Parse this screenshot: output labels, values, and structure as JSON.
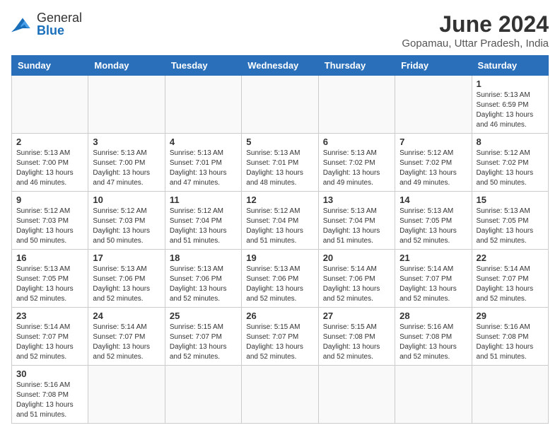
{
  "header": {
    "logo_general": "General",
    "logo_blue": "Blue",
    "month_title": "June 2024",
    "location": "Gopamau, Uttar Pradesh, India"
  },
  "weekdays": [
    "Sunday",
    "Monday",
    "Tuesday",
    "Wednesday",
    "Thursday",
    "Friday",
    "Saturday"
  ],
  "weeks": [
    [
      {
        "day": "",
        "info": ""
      },
      {
        "day": "",
        "info": ""
      },
      {
        "day": "",
        "info": ""
      },
      {
        "day": "",
        "info": ""
      },
      {
        "day": "",
        "info": ""
      },
      {
        "day": "",
        "info": ""
      },
      {
        "day": "1",
        "info": "Sunrise: 5:13 AM\nSunset: 6:59 PM\nDaylight: 13 hours and 46 minutes."
      }
    ],
    [
      {
        "day": "2",
        "info": "Sunrise: 5:13 AM\nSunset: 7:00 PM\nDaylight: 13 hours and 46 minutes."
      },
      {
        "day": "3",
        "info": "Sunrise: 5:13 AM\nSunset: 7:00 PM\nDaylight: 13 hours and 47 minutes."
      },
      {
        "day": "4",
        "info": "Sunrise: 5:13 AM\nSunset: 7:01 PM\nDaylight: 13 hours and 47 minutes."
      },
      {
        "day": "5",
        "info": "Sunrise: 5:13 AM\nSunset: 7:01 PM\nDaylight: 13 hours and 48 minutes."
      },
      {
        "day": "6",
        "info": "Sunrise: 5:13 AM\nSunset: 7:02 PM\nDaylight: 13 hours and 49 minutes."
      },
      {
        "day": "7",
        "info": "Sunrise: 5:12 AM\nSunset: 7:02 PM\nDaylight: 13 hours and 49 minutes."
      },
      {
        "day": "8",
        "info": "Sunrise: 5:12 AM\nSunset: 7:02 PM\nDaylight: 13 hours and 50 minutes."
      }
    ],
    [
      {
        "day": "9",
        "info": "Sunrise: 5:12 AM\nSunset: 7:03 PM\nDaylight: 13 hours and 50 minutes."
      },
      {
        "day": "10",
        "info": "Sunrise: 5:12 AM\nSunset: 7:03 PM\nDaylight: 13 hours and 50 minutes."
      },
      {
        "day": "11",
        "info": "Sunrise: 5:12 AM\nSunset: 7:04 PM\nDaylight: 13 hours and 51 minutes."
      },
      {
        "day": "12",
        "info": "Sunrise: 5:12 AM\nSunset: 7:04 PM\nDaylight: 13 hours and 51 minutes."
      },
      {
        "day": "13",
        "info": "Sunrise: 5:13 AM\nSunset: 7:04 PM\nDaylight: 13 hours and 51 minutes."
      },
      {
        "day": "14",
        "info": "Sunrise: 5:13 AM\nSunset: 7:05 PM\nDaylight: 13 hours and 52 minutes."
      },
      {
        "day": "15",
        "info": "Sunrise: 5:13 AM\nSunset: 7:05 PM\nDaylight: 13 hours and 52 minutes."
      }
    ],
    [
      {
        "day": "16",
        "info": "Sunrise: 5:13 AM\nSunset: 7:05 PM\nDaylight: 13 hours and 52 minutes."
      },
      {
        "day": "17",
        "info": "Sunrise: 5:13 AM\nSunset: 7:06 PM\nDaylight: 13 hours and 52 minutes."
      },
      {
        "day": "18",
        "info": "Sunrise: 5:13 AM\nSunset: 7:06 PM\nDaylight: 13 hours and 52 minutes."
      },
      {
        "day": "19",
        "info": "Sunrise: 5:13 AM\nSunset: 7:06 PM\nDaylight: 13 hours and 52 minutes."
      },
      {
        "day": "20",
        "info": "Sunrise: 5:14 AM\nSunset: 7:06 PM\nDaylight: 13 hours and 52 minutes."
      },
      {
        "day": "21",
        "info": "Sunrise: 5:14 AM\nSunset: 7:07 PM\nDaylight: 13 hours and 52 minutes."
      },
      {
        "day": "22",
        "info": "Sunrise: 5:14 AM\nSunset: 7:07 PM\nDaylight: 13 hours and 52 minutes."
      }
    ],
    [
      {
        "day": "23",
        "info": "Sunrise: 5:14 AM\nSunset: 7:07 PM\nDaylight: 13 hours and 52 minutes."
      },
      {
        "day": "24",
        "info": "Sunrise: 5:14 AM\nSunset: 7:07 PM\nDaylight: 13 hours and 52 minutes."
      },
      {
        "day": "25",
        "info": "Sunrise: 5:15 AM\nSunset: 7:07 PM\nDaylight: 13 hours and 52 minutes."
      },
      {
        "day": "26",
        "info": "Sunrise: 5:15 AM\nSunset: 7:07 PM\nDaylight: 13 hours and 52 minutes."
      },
      {
        "day": "27",
        "info": "Sunrise: 5:15 AM\nSunset: 7:08 PM\nDaylight: 13 hours and 52 minutes."
      },
      {
        "day": "28",
        "info": "Sunrise: 5:16 AM\nSunset: 7:08 PM\nDaylight: 13 hours and 52 minutes."
      },
      {
        "day": "29",
        "info": "Sunrise: 5:16 AM\nSunset: 7:08 PM\nDaylight: 13 hours and 51 minutes."
      }
    ],
    [
      {
        "day": "30",
        "info": "Sunrise: 5:16 AM\nSunset: 7:08 PM\nDaylight: 13 hours and 51 minutes."
      },
      {
        "day": "",
        "info": ""
      },
      {
        "day": "",
        "info": ""
      },
      {
        "day": "",
        "info": ""
      },
      {
        "day": "",
        "info": ""
      },
      {
        "day": "",
        "info": ""
      },
      {
        "day": "",
        "info": ""
      }
    ]
  ]
}
